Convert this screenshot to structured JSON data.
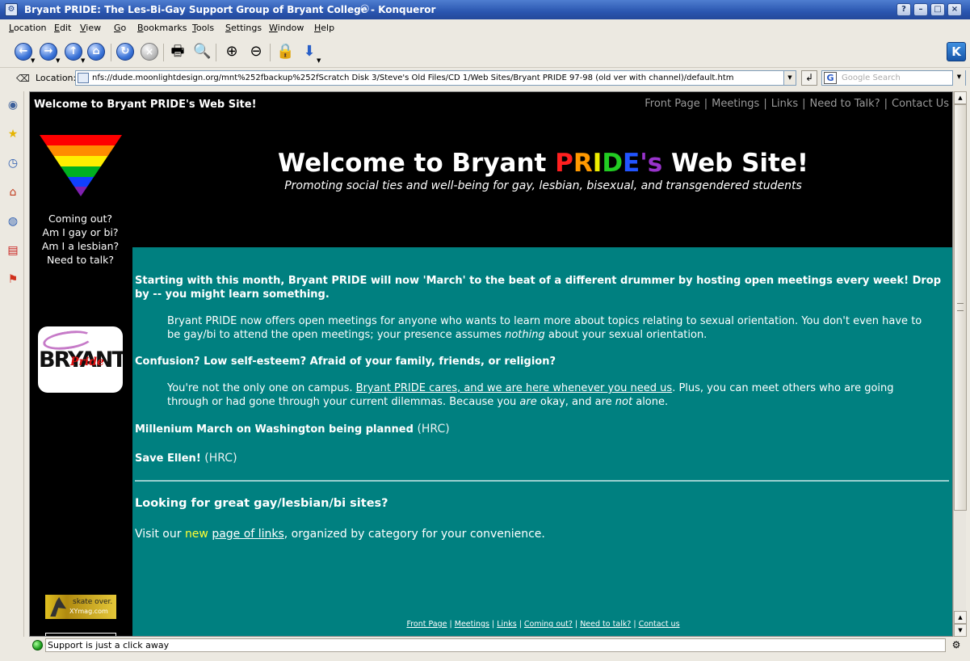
{
  "window": {
    "title": "Bryant PRIDE: The Les-Bi-Gay Support Group of Bryant College - Konqueror",
    "buttons": {
      "help": "?",
      "minimize": "–",
      "maximize": "□",
      "close": "×"
    }
  },
  "menu": {
    "items": [
      {
        "u": "L",
        "rest": "ocation"
      },
      {
        "u": "E",
        "rest": "dit"
      },
      {
        "u": "V",
        "rest": "iew"
      },
      {
        "u": "G",
        "rest": "o"
      },
      {
        "u": "B",
        "rest": "ookmarks"
      },
      {
        "u": "T",
        "rest": "ools"
      },
      {
        "u": "S",
        "rest": "ettings"
      },
      {
        "u": "W",
        "rest": "indow"
      },
      {
        "u": "H",
        "rest": "elp"
      }
    ]
  },
  "toolbar": {
    "icons": [
      "back-icon",
      "forward-icon",
      "up-icon",
      "home-icon",
      "reload-icon",
      "stop-icon",
      "print-icon",
      "find-icon",
      "zoom-in-icon",
      "zoom-out-icon",
      "security-lock-icon",
      "download-icon"
    ]
  },
  "location": {
    "label": "Location:",
    "url": "nfs://dude.moonlightdesign.org/mnt%252fbackup%252fScratch Disk 3/Steve's Old Files/CD 1/Web Sites/Bryant PRIDE 97-98 (old ver with channel)/default.htm",
    "search_placeholder": "Google Search"
  },
  "page": {
    "header_small": "Welcome to Bryant PRIDE's Web Site!",
    "top_nav": [
      "Front Page",
      "Meetings",
      "Links",
      "Need to Talk?",
      "Contact Us"
    ],
    "coming_out": [
      "Coming out?",
      "Am I gay or bi?",
      "Am I a lesbian?",
      "Need to talk?"
    ],
    "logo": {
      "bryant": "BRYANT",
      "pride": "Pride"
    },
    "skate_ad": {
      "line1": "skate over.",
      "line2": "XYmag.com"
    },
    "banner": {
      "title_before": "Welcome to Bryant ",
      "pride_letters": [
        "P",
        "R",
        "I",
        "D",
        "E",
        "'s"
      ],
      "title_after": " Web Site!",
      "tagline": "Promoting social ties and well-being for gay, lesbian, bisexual, and transgendered students"
    },
    "news": {
      "march_headline": "Starting with this month, Bryant PRIDE will now 'March' to the beat of a different drummer by hosting open meetings every week! Drop by -- you might learn something.",
      "meetings_body_before": "Bryant PRIDE now offers open meetings for anyone who wants to learn more about topics relating to sexual orientation. You don't even have to be gay/bi to attend the open meetings; your presence assumes ",
      "meetings_body_em": "nothing",
      "meetings_body_after": " about your sexual orientation.",
      "confusion_headline": "Confusion? Low self-esteem? Afraid of your family, friends, or religion?",
      "confusion_before": "You're not the only one on campus. ",
      "confusion_link": "Bryant PRIDE cares, and we are here whenever you need us",
      "confusion_middle": ". Plus, you can meet others who are going through or had gone through your current dilemmas. Because you ",
      "confusion_are": "are",
      "confusion_okay": " okay, and are ",
      "confusion_not": "not",
      "confusion_end": " alone.",
      "millenium": "Millenium March on Washington being planned",
      "millenium_src": "(HRC)",
      "ellen": "Save Ellen!",
      "ellen_src": "(HRC)",
      "looking": "Looking for great gay/lesbian/bi sites?",
      "visit_before": "Visit our ",
      "visit_new": "new",
      "visit_link": "page of links",
      "visit_after": ", organized by category for your convenience."
    },
    "footer_nav": [
      "Front Page",
      "Meetings",
      "Links",
      "Coming out?",
      "Need to talk?",
      "Contact us"
    ]
  },
  "status": {
    "text": "Support is just a click away"
  },
  "colors": {
    "teal": "#008080",
    "titlebar": "#2a56b0",
    "new_highlight": "#ffff33"
  }
}
